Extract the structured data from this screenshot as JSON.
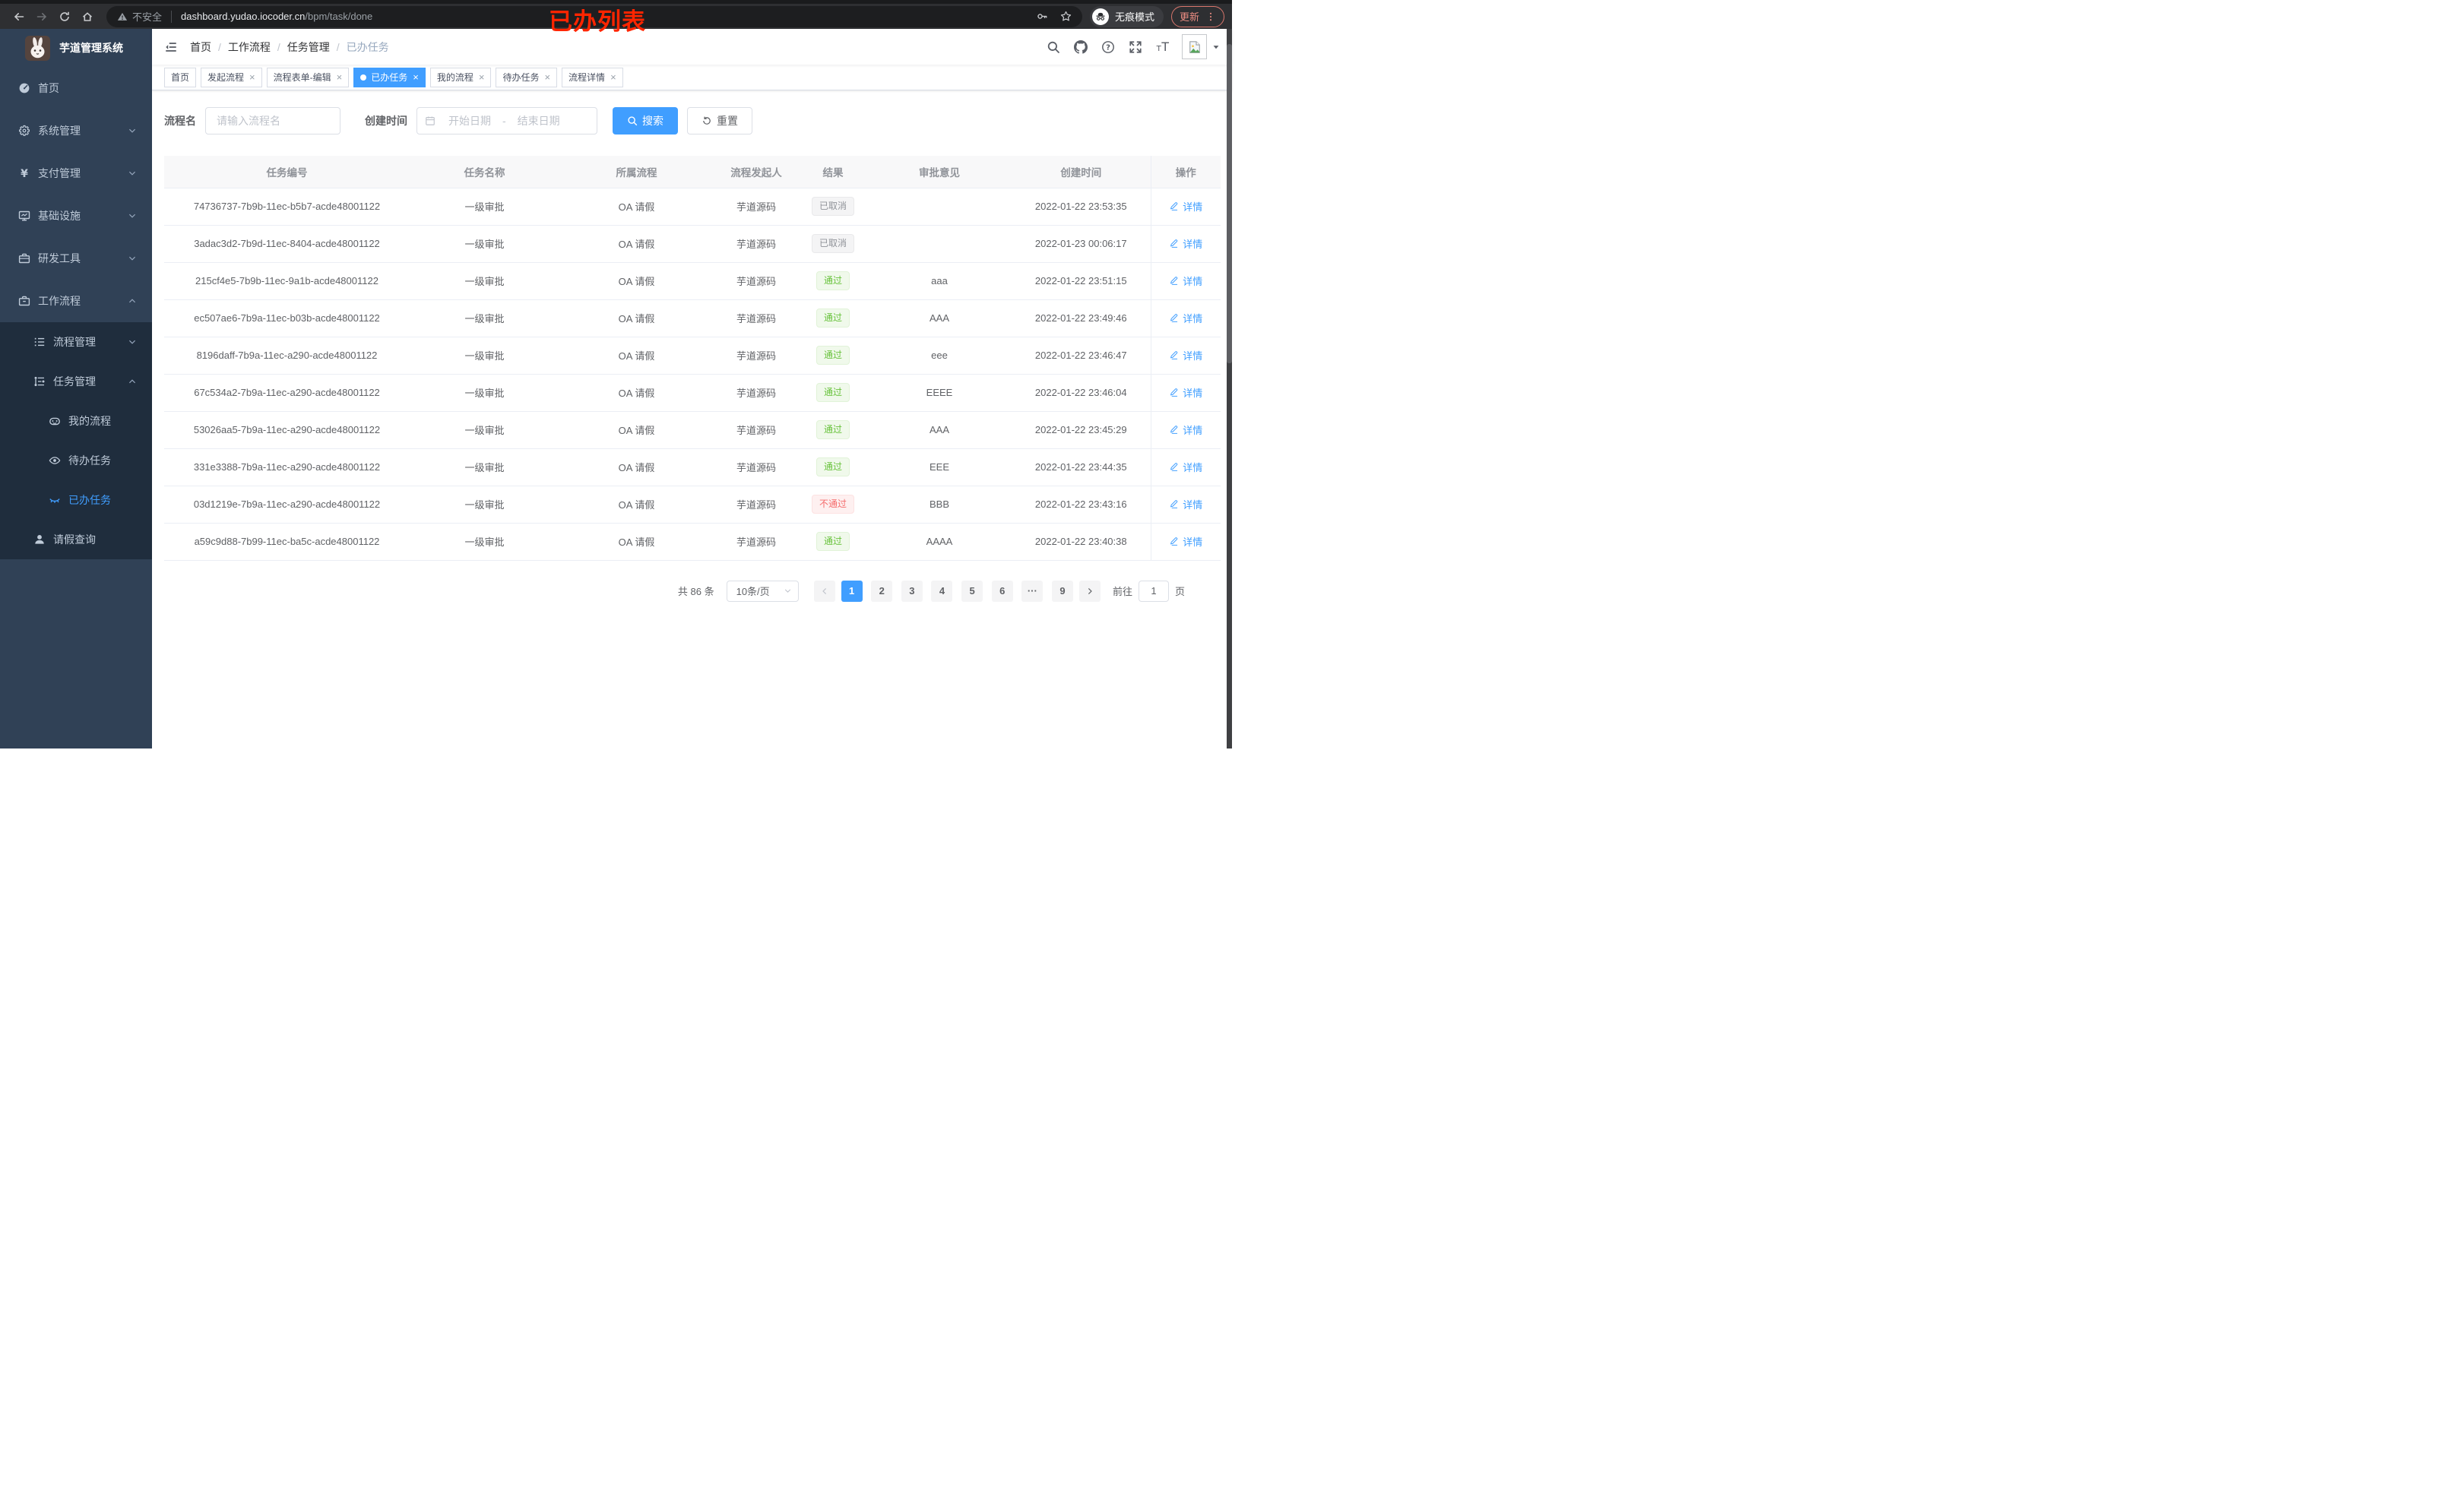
{
  "browser": {
    "security_warning": "不安全",
    "url_host": "dashboard.yudao.iocoder.cn",
    "url_path": "/bpm/task/done",
    "incognito_label": "无痕模式",
    "update_label": "更新"
  },
  "annotation": "已办列表",
  "sidebar": {
    "app_title": "芋道管理系统",
    "items": [
      {
        "label": "首页",
        "icon": "dashboard",
        "level_class": "lv1"
      },
      {
        "label": "系统管理",
        "icon": "gear",
        "level_class": "lv1",
        "has_arrow": true
      },
      {
        "label": "支付管理",
        "icon": "yen",
        "level_class": "lv1",
        "has_arrow": true
      },
      {
        "label": "基础设施",
        "icon": "monitor",
        "level_class": "lv1",
        "has_arrow": true
      },
      {
        "label": "研发工具",
        "icon": "toolbox",
        "level_class": "lv1",
        "has_arrow": true
      },
      {
        "label": "工作流程",
        "icon": "suitcase",
        "level_class": "lv1",
        "has_arrow": true,
        "arrow_up": true
      },
      {
        "label": "流程管理",
        "icon": "list",
        "level_class": "lv2",
        "sub": true,
        "has_arrow": true
      },
      {
        "label": "任务管理",
        "icon": "tree",
        "level_class": "lv2",
        "sub": true,
        "has_arrow": true,
        "arrow_up": true
      },
      {
        "label": "我的流程",
        "icon": "robot",
        "level_class": "lv3",
        "sub": true
      },
      {
        "label": "待办任务",
        "icon": "eye",
        "level_class": "lv3",
        "sub": true
      },
      {
        "label": "已办任务",
        "icon": "eye-closed",
        "level_class": "lv3",
        "sub": true,
        "active": true
      },
      {
        "label": "请假查询",
        "icon": "user",
        "level_class": "lv2",
        "sub": true
      }
    ]
  },
  "breadcrumb": {
    "items": [
      {
        "label": "首页"
      },
      {
        "label": "工作流程",
        "sep": true
      },
      {
        "label": "任务管理",
        "sep": true
      },
      {
        "label": "已办任务",
        "sep": true,
        "current": true
      }
    ]
  },
  "tabs": [
    {
      "label": "首页"
    },
    {
      "label": "发起流程",
      "closable": true
    },
    {
      "label": "流程表单-编辑",
      "closable": true
    },
    {
      "label": "已办任务",
      "closable": true,
      "active": true
    },
    {
      "label": "我的流程",
      "closable": true
    },
    {
      "label": "待办任务",
      "closable": true
    },
    {
      "label": "流程详情",
      "closable": true
    }
  ],
  "filters": {
    "name_label": "流程名",
    "name_placeholder": "请输入流程名",
    "time_label": "创建时间",
    "start_placeholder": "开始日期",
    "range_separator": "-",
    "end_placeholder": "结束日期",
    "search_label": "搜索",
    "reset_label": "重置"
  },
  "table": {
    "columns": [
      "任务编号",
      "任务名称",
      "所属流程",
      "流程发起人",
      "结果",
      "审批意见",
      "创建时间",
      "操作"
    ],
    "detail_label": "详情",
    "rows": [
      {
        "id": "74736737-7b9b-11ec-b5b7-acde48001122",
        "name": "一级审批",
        "process": "OA 请假",
        "starter": "芋道源码",
        "result": "已取消",
        "result_class": "info",
        "comment": "",
        "created": "2022-01-22 23:53:35"
      },
      {
        "id": "3adac3d2-7b9d-11ec-8404-acde48001122",
        "name": "一级审批",
        "process": "OA 请假",
        "starter": "芋道源码",
        "result": "已取消",
        "result_class": "info",
        "comment": "",
        "created": "2022-01-23 00:06:17"
      },
      {
        "id": "215cf4e5-7b9b-11ec-9a1b-acde48001122",
        "name": "一级审批",
        "process": "OA 请假",
        "starter": "芋道源码",
        "result": "通过",
        "result_class": "success",
        "comment": "aaa",
        "created": "2022-01-22 23:51:15"
      },
      {
        "id": "ec507ae6-7b9a-11ec-b03b-acde48001122",
        "name": "一级审批",
        "process": "OA 请假",
        "starter": "芋道源码",
        "result": "通过",
        "result_class": "success",
        "comment": "AAA",
        "created": "2022-01-22 23:49:46"
      },
      {
        "id": "8196daff-7b9a-11ec-a290-acde48001122",
        "name": "一级审批",
        "process": "OA 请假",
        "starter": "芋道源码",
        "result": "通过",
        "result_class": "success",
        "comment": "eee",
        "created": "2022-01-22 23:46:47"
      },
      {
        "id": "67c534a2-7b9a-11ec-a290-acde48001122",
        "name": "一级审批",
        "process": "OA 请假",
        "starter": "芋道源码",
        "result": "通过",
        "result_class": "success",
        "comment": "EEEE",
        "created": "2022-01-22 23:46:04"
      },
      {
        "id": "53026aa5-7b9a-11ec-a290-acde48001122",
        "name": "一级审批",
        "process": "OA 请假",
        "starter": "芋道源码",
        "result": "通过",
        "result_class": "success",
        "comment": "AAA",
        "created": "2022-01-22 23:45:29"
      },
      {
        "id": "331e3388-7b9a-11ec-a290-acde48001122",
        "name": "一级审批",
        "process": "OA 请假",
        "starter": "芋道源码",
        "result": "通过",
        "result_class": "success",
        "comment": "EEE",
        "created": "2022-01-22 23:44:35"
      },
      {
        "id": "03d1219e-7b9a-11ec-a290-acde48001122",
        "name": "一级审批",
        "process": "OA 请假",
        "starter": "芋道源码",
        "result": "不通过",
        "result_class": "danger",
        "comment": "BBB",
        "created": "2022-01-22 23:43:16"
      },
      {
        "id": "a59c9d88-7b99-11ec-ba5c-acde48001122",
        "name": "一级审批",
        "process": "OA 请假",
        "starter": "芋道源码",
        "result": "通过",
        "result_class": "success",
        "comment": "AAAA",
        "created": "2022-01-22 23:40:38"
      }
    ]
  },
  "pagination": {
    "total_text": "共 86 条",
    "page_size": "10条/页",
    "pages": [
      {
        "label": "1",
        "active": true
      },
      {
        "label": "2"
      },
      {
        "label": "3"
      },
      {
        "label": "4"
      },
      {
        "label": "5"
      },
      {
        "label": "6"
      },
      {
        "label": "···"
      },
      {
        "label": "9"
      }
    ],
    "goto_label": "前往",
    "goto_value": "1",
    "page_unit": "页"
  },
  "colors": {
    "accent": "#409eff",
    "success": "#67c23a",
    "danger": "#f56c6c",
    "info": "#909399",
    "sidebar_bg": "#304156",
    "submenu_bg": "#1f2d3d"
  }
}
